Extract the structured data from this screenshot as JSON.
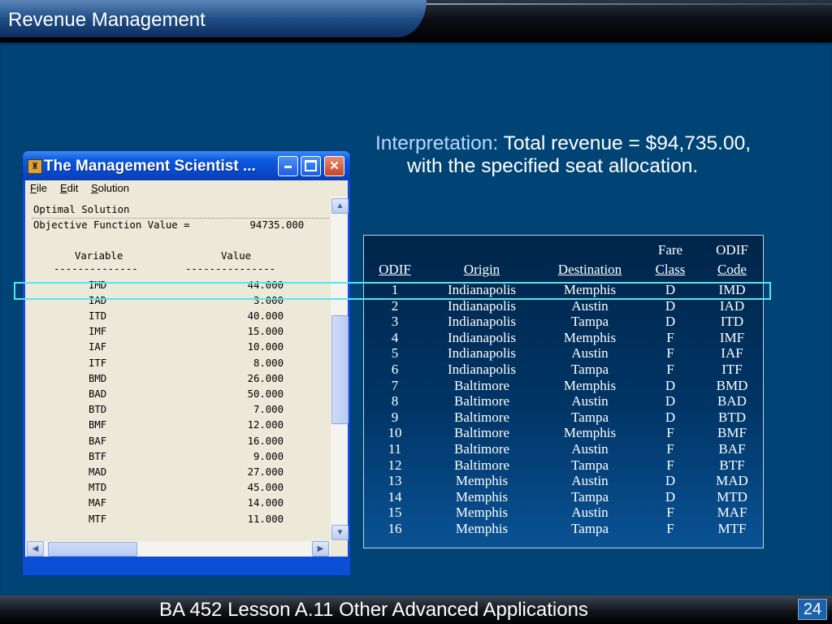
{
  "slide": {
    "title": "Revenue Management",
    "footer": "BA 452  Lesson A.11 Other Advanced Applications",
    "page_number": "24"
  },
  "window": {
    "title": "The Management Scientist ...",
    "menu": [
      "File",
      "Edit",
      "Solution"
    ],
    "output": {
      "heading": "Optimal Solution",
      "objective_line": "Objective Function Value =          94735.000",
      "col_variable": "Variable",
      "col_value": "Value",
      "underline_var": "--------------",
      "underline_val": "---------------",
      "rows": [
        {
          "var": "IMD",
          "val": "44.000"
        },
        {
          "var": "IAD",
          "val": "3.000"
        },
        {
          "var": "ITD",
          "val": "40.000"
        },
        {
          "var": "IMF",
          "val": "15.000"
        },
        {
          "var": "IAF",
          "val": "10.000"
        },
        {
          "var": "ITF",
          "val": "8.000"
        },
        {
          "var": "BMD",
          "val": "26.000"
        },
        {
          "var": "BAD",
          "val": "50.000"
        },
        {
          "var": "BTD",
          "val": "7.000"
        },
        {
          "var": "BMF",
          "val": "12.000"
        },
        {
          "var": "BAF",
          "val": "16.000"
        },
        {
          "var": "BTF",
          "val": "9.000"
        },
        {
          "var": "MAD",
          "val": "27.000"
        },
        {
          "var": "MTD",
          "val": "45.000"
        },
        {
          "var": "MAF",
          "val": "14.000"
        },
        {
          "var": "MTF",
          "val": "11.000"
        }
      ]
    }
  },
  "interpretation": {
    "label": "Interpretation:",
    "text1": "Total revenue = $94,735.00,",
    "text2": "with the specified seat allocation."
  },
  "table": {
    "headers_top": [
      "",
      "",
      "",
      "Fare",
      "ODIF"
    ],
    "headers": [
      "ODIF",
      "Origin",
      "Destination",
      "Class",
      "Code"
    ],
    "rows": [
      [
        "1",
        "Indianapolis",
        "Memphis",
        "D",
        "IMD"
      ],
      [
        "2",
        "Indianapolis",
        "Austin",
        "D",
        "IAD"
      ],
      [
        "3",
        "Indianapolis",
        "Tampa",
        "D",
        "ITD"
      ],
      [
        "4",
        "Indianapolis",
        "Memphis",
        "F",
        "IMF"
      ],
      [
        "5",
        "Indianapolis",
        "Austin",
        "F",
        "IAF"
      ],
      [
        "6",
        "Indianapolis",
        "Tampa",
        "F",
        "ITF"
      ],
      [
        "7",
        "Baltimore",
        "Memphis",
        "D",
        "BMD"
      ],
      [
        "8",
        "Baltimore",
        "Austin",
        "D",
        "BAD"
      ],
      [
        "9",
        "Baltimore",
        "Tampa",
        "D",
        "BTD"
      ],
      [
        "10",
        "Baltimore",
        "Memphis",
        "F",
        "BMF"
      ],
      [
        "11",
        "Baltimore",
        "Austin",
        "F",
        "BAF"
      ],
      [
        "12",
        "Baltimore",
        "Tampa",
        "F",
        "BTF"
      ],
      [
        "13",
        "Memphis",
        "Austin",
        "D",
        "MAD"
      ],
      [
        "14",
        "Memphis",
        "Tampa",
        "D",
        "MTD"
      ],
      [
        "15",
        "Memphis",
        "Austin",
        "F",
        "MAF"
      ],
      [
        "16",
        "Memphis",
        "Tampa",
        "F",
        "MTF"
      ]
    ]
  }
}
